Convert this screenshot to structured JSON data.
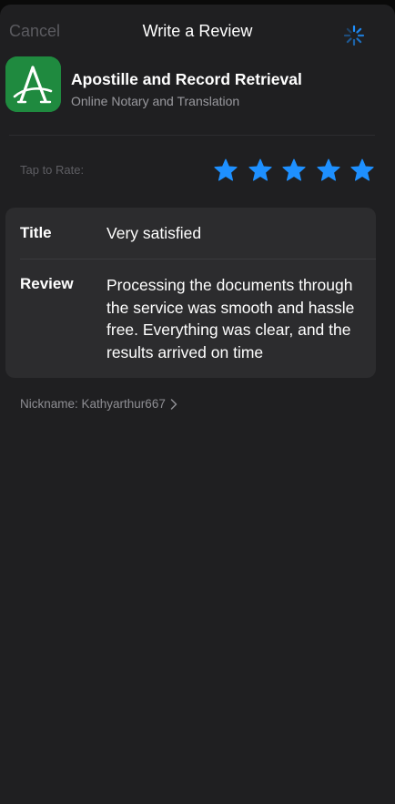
{
  "header": {
    "cancel_label": "Cancel",
    "title": "Write a Review",
    "loading_icon": "activity-spinner-icon"
  },
  "app": {
    "name": "Apostille and Record Retrieval",
    "subtitle": "Online Notary and Translation",
    "icon_letter": "A",
    "icon_color": "#1f8a3f"
  },
  "rating": {
    "label": "Tap to Rate:",
    "value": 5,
    "max": 5,
    "star_color": "#1e90ff"
  },
  "form": {
    "title_label": "Title",
    "title_value": "Very satisfied",
    "review_label": "Review",
    "review_value": "Processing the documents through the service was smooth and hassle free. Everything was clear, and the results arrived on time"
  },
  "nickname": {
    "text": "Nickname: Kathyarthur667",
    "icon": "chevron-right-icon"
  },
  "colors": {
    "background": "#1f1f21",
    "card": "#2c2c2e",
    "accent": "#1e90ff"
  }
}
